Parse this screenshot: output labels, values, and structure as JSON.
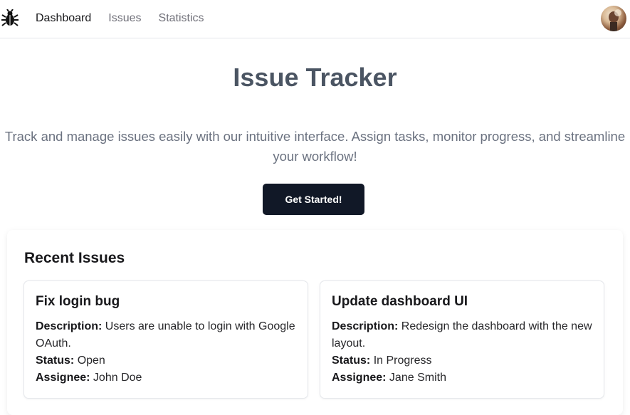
{
  "nav": {
    "logo_icon": "bug-icon",
    "links": [
      {
        "label": "Dashboard",
        "active": true
      },
      {
        "label": "Issues",
        "active": false
      },
      {
        "label": "Statistics",
        "active": false
      }
    ],
    "avatar_icon": "user-avatar"
  },
  "hero": {
    "title": "Issue Tracker",
    "description": "Track and manage issues easily with our intuitive interface. Assign tasks, monitor progress, and streamline your workflow!",
    "cta_label": "Get Started!"
  },
  "recent": {
    "title": "Recent Issues",
    "issues": [
      {
        "title": "Fix login bug",
        "description_label": "Description:",
        "description": "Users are unable to login with Google OAuth.",
        "status_label": "Status:",
        "status": "Open",
        "assignee_label": "Assignee:",
        "assignee": "John Doe"
      },
      {
        "title": "Update dashboard UI",
        "description_label": "Description:",
        "description": "Redesign the dashboard with the new layout.",
        "status_label": "Status:",
        "status": "In Progress",
        "assignee_label": "Assignee:",
        "assignee": "Jane Smith"
      }
    ]
  },
  "colors": {
    "cta_background": "#111827",
    "title_text": "#4b5563",
    "muted_text": "#6b7280"
  }
}
